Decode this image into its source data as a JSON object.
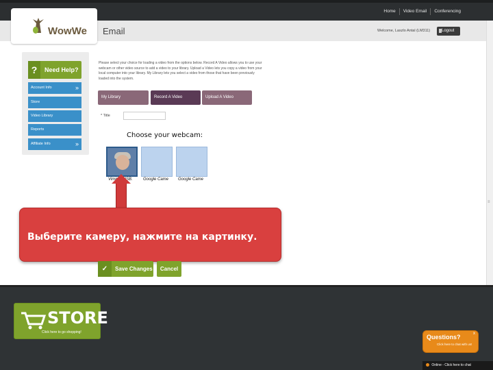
{
  "topnav": [
    "Home",
    "Video Email",
    "Conferencing"
  ],
  "logo": {
    "text": "WowWe"
  },
  "page_title": "Email",
  "welcome": "Welcome, Laszlo Antal (LM311)",
  "logout_label": "Logout",
  "sidebar": {
    "help_mark": "?",
    "help_label": "Need Help?",
    "items": [
      "Account Info",
      "Store",
      "Video Library",
      "Reports",
      "Affiliate Info"
    ]
  },
  "intro_text": "Please select your choice for loading a video from the options below. Record A Video allows you to use your webcam or other video source to add a video to your library. Upload a Video lets you copy a video from your local computer into your library. My Library lets you select a video from those that have been previously loaded into the system.",
  "tabs": [
    "My Library",
    "Record A Video",
    "Upload A Video"
  ],
  "title_label": "* Title",
  "choose_webcam": "Choose your webcam:",
  "cameras": [
    "Vimicro USB.",
    "Google Came",
    "Google Came"
  ],
  "callout_text": "Выберите камеру, нажмите на картинку.",
  "buttons": {
    "save": "Save Changes",
    "save_icon": "✓",
    "cancel": "Cancel"
  },
  "store": {
    "big": "STORE",
    "small": "Click here to go shopping!"
  },
  "chat": {
    "title": "Questions?",
    "subtitle": "Click here to chat with us!",
    "close": "x",
    "online": "Online - Click here to chat"
  },
  "colors": {
    "green": "#7fa32c",
    "blue": "#3a90c9",
    "plum": "#5a3a55",
    "red": "#d9403f",
    "orange": "#e88a1a"
  }
}
